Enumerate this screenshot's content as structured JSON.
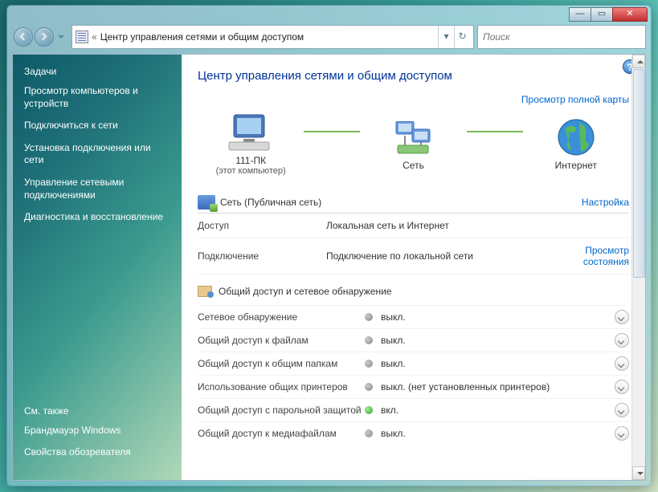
{
  "window": {
    "title_prefix": "«",
    "title": "Центр управления сетями и общим доступом",
    "search_placeholder": "Поиск"
  },
  "sidebar": {
    "heading": "Задачи",
    "items": [
      "Просмотр компьютеров и устройств",
      "Подключиться к сети",
      "Установка подключения или сети",
      "Управление сетевыми подключениями",
      "Диагностика и восстановление"
    ],
    "see_also_heading": "См. также",
    "see_also": [
      "Брандмауэр Windows",
      "Свойства обозревателя"
    ]
  },
  "main": {
    "page_title": "Центр управления сетями и общим доступом",
    "view_full_map": "Просмотр полной карты",
    "map": {
      "pc_name": "111-ПК",
      "pc_sub": "(этот компьютер)",
      "network_label": "Сеть",
      "internet_label": "Интернет"
    },
    "network_section": {
      "title": "Сеть (Публичная сеть)",
      "customize": "Настройка",
      "rows": [
        {
          "k": "Доступ",
          "v": "Локальная сеть и Интернет",
          "link": ""
        },
        {
          "k": "Подключение",
          "v": "Подключение по локальной сети",
          "link": "Просмотр состояния"
        }
      ]
    },
    "sharing_section": {
      "title": "Общий доступ и сетевое обнаружение",
      "items": [
        {
          "name": "Сетевое обнаружение",
          "state": "off",
          "value": "выкл."
        },
        {
          "name": "Общий доступ к файлам",
          "state": "off",
          "value": "выкл."
        },
        {
          "name": "Общий доступ к общим папкам",
          "state": "off",
          "value": "выкл."
        },
        {
          "name": "Использование общих принтеров",
          "state": "off",
          "value": "выкл. (нет установленных принтеров)"
        },
        {
          "name": "Общий доступ с парольной защитой",
          "state": "on",
          "value": "вкл."
        },
        {
          "name": "Общий доступ к медиафайлам",
          "state": "off",
          "value": "выкл."
        }
      ]
    }
  }
}
